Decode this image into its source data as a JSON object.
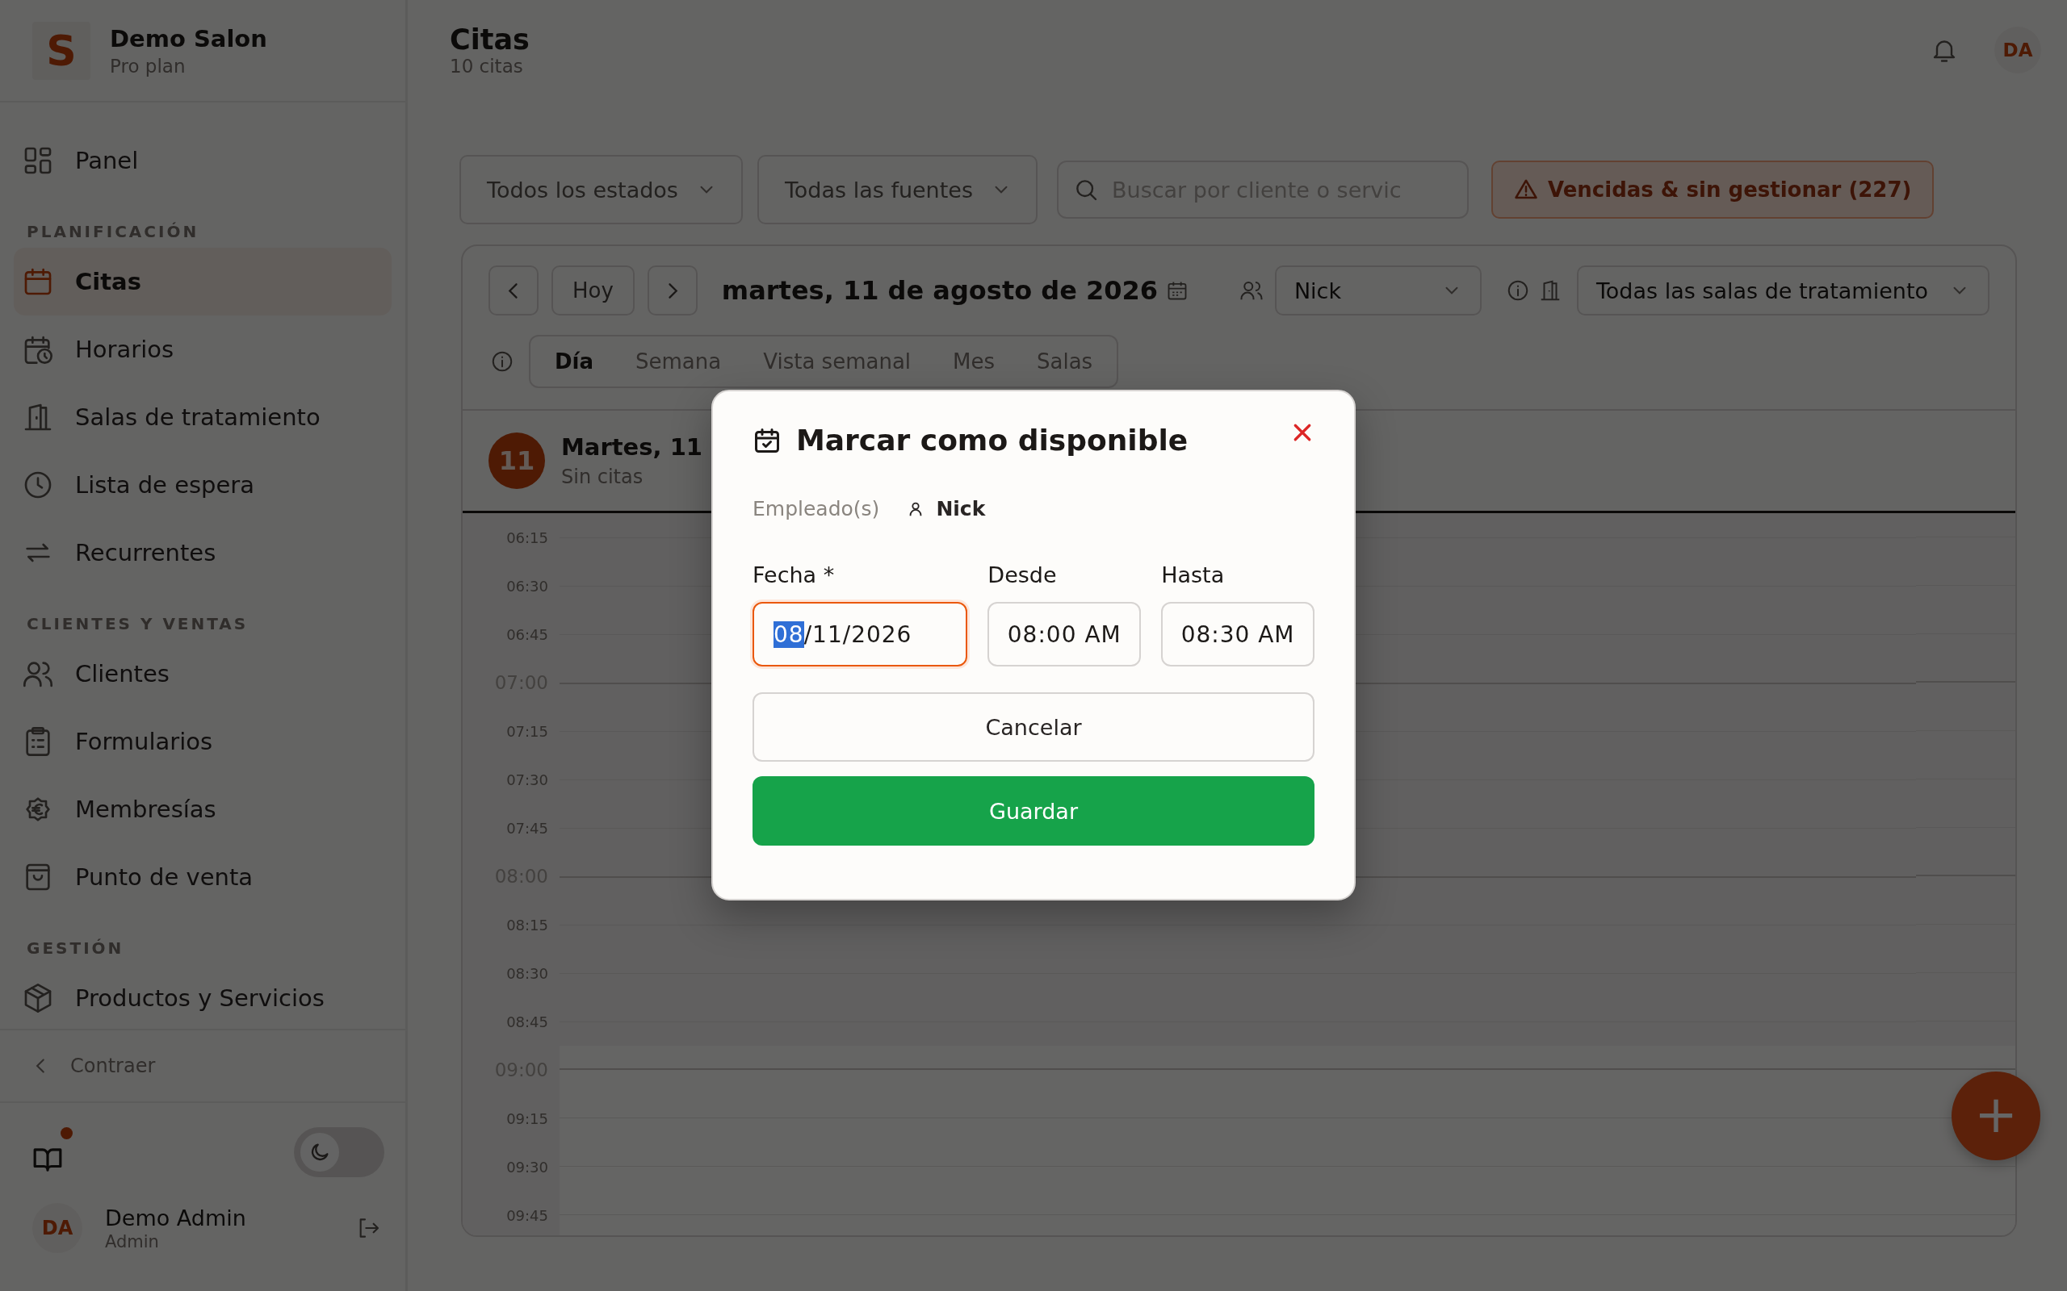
{
  "sidebar": {
    "brand": {
      "logo_letter": "S",
      "name": "Demo Salon",
      "plan": "Pro plan"
    },
    "sections": [
      {
        "items": [
          {
            "label": "Panel",
            "selected": false
          }
        ]
      },
      {
        "heading": "PLANIFICACIÓN",
        "items": [
          {
            "label": "Citas",
            "selected": true
          },
          {
            "label": "Horarios",
            "selected": false
          },
          {
            "label": "Salas de tratamiento",
            "selected": false
          },
          {
            "label": "Lista de espera",
            "selected": false
          },
          {
            "label": "Recurrentes",
            "selected": false
          }
        ]
      },
      {
        "heading": "CLIENTES Y VENTAS",
        "items": [
          {
            "label": "Clientes",
            "selected": false
          },
          {
            "label": "Formularios",
            "selected": false
          },
          {
            "label": "Membresías",
            "selected": false
          },
          {
            "label": "Punto de venta",
            "selected": false
          }
        ]
      },
      {
        "heading": "GESTIÓN",
        "items": [
          {
            "label": "Productos y Servicios",
            "selected": false
          }
        ]
      }
    ],
    "collapse": "Contraer",
    "guide_notification": true,
    "dark_mode": false,
    "user": {
      "initials": "DA",
      "name": "Demo Admin",
      "role": "Admin"
    }
  },
  "header": {
    "title": "Citas",
    "subtitle": "10 citas",
    "avatar": "DA"
  },
  "filters": {
    "selects": [
      "Todos los estados",
      "Todas las fuentes"
    ],
    "search": {
      "placeholder": "Buscar por cliente o servic"
    },
    "alert_button": "Vencidas & sin gestionar (227)"
  },
  "calendar": {
    "today_button": "Hoy",
    "date": "martes, 11 de agosto de 2026",
    "employee": "Nick",
    "room": "Todas las salas de tratamiento",
    "views": [
      {
        "label": "Día",
        "selected": true
      },
      {
        "label": "Semana",
        "selected": false
      },
      {
        "label": "Vista semanal",
        "selected": false
      },
      {
        "label": "Mes",
        "selected": false
      },
      {
        "label": "Salas",
        "selected": false
      }
    ],
    "day": {
      "badge": "11",
      "title": "Martes, 11",
      "subtitle": "Sin citas"
    },
    "slots": [
      {
        "time": "06:15",
        "kind": "quarter",
        "open": false
      },
      {
        "time": "06:30",
        "kind": "quarter",
        "open": false
      },
      {
        "time": "06:45",
        "kind": "quarter",
        "open": false
      },
      {
        "time": "07:00",
        "kind": "hour",
        "open": false
      },
      {
        "time": "07:15",
        "kind": "quarter",
        "open": false
      },
      {
        "time": "07:30",
        "kind": "quarter",
        "open": false
      },
      {
        "time": "07:45",
        "kind": "quarter",
        "open": false
      },
      {
        "time": "08:00",
        "kind": "hour",
        "open": false
      },
      {
        "time": "08:15",
        "kind": "quarter",
        "open": false
      },
      {
        "time": "08:30",
        "kind": "quarter",
        "open": false
      },
      {
        "time": "08:45",
        "kind": "quarter",
        "open": false
      },
      {
        "time": "09:00",
        "kind": "hour",
        "open": true
      },
      {
        "time": "09:15",
        "kind": "quarter",
        "open": true
      },
      {
        "time": "09:30",
        "kind": "quarter",
        "open": true
      },
      {
        "time": "09:45",
        "kind": "quarter",
        "open": true
      }
    ]
  },
  "fab": "+",
  "modal": {
    "title": "Marcar como disponible",
    "employee_label": "Empleado(s)",
    "employee": "Nick",
    "fields": [
      {
        "label": "Fecha *",
        "focused": true,
        "segments": [
          {
            "text": "08",
            "selected": true
          },
          {
            "text": "/11/2026",
            "selected": false
          }
        ]
      },
      {
        "label": "Desde",
        "focused": false,
        "segments": [
          {
            "text": "08:00 AM",
            "selected": false
          }
        ]
      },
      {
        "label": "Hasta",
        "focused": false,
        "segments": [
          {
            "text": "08:30 AM",
            "selected": false
          }
        ]
      }
    ],
    "buttons": [
      {
        "label": "Cancelar",
        "kind": "secondary"
      },
      {
        "label": "Guardar",
        "kind": "primary"
      }
    ]
  }
}
